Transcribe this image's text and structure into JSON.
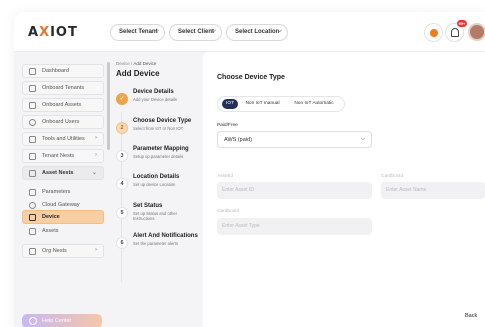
{
  "app": {
    "logo_prefix": "A",
    "logo_x": "X",
    "logo_suffix": "IOT"
  },
  "header": {
    "selectors": [
      {
        "label": "Select Tenant"
      },
      {
        "label": "Select Client"
      },
      {
        "label": "Select Location"
      }
    ],
    "notification_count": "99+",
    "user_initial": "F"
  },
  "sidebar": {
    "items": [
      {
        "label": "Dashboard",
        "icon": "dashboard-icon"
      },
      {
        "label": "Onboard Tenants",
        "icon": "tenants-icon"
      },
      {
        "label": "Onboard Assets",
        "icon": "assets-icon"
      },
      {
        "label": "Onboard Users",
        "icon": "users-icon"
      },
      {
        "label": "Tools and Utilities",
        "icon": "tools-icon"
      },
      {
        "label": "Tenant Nests",
        "icon": "nests-icon"
      },
      {
        "label": "Asset Nests",
        "icon": "asset-nests-icon"
      },
      {
        "label": "Parameters",
        "icon": "parameters-icon"
      },
      {
        "label": "Cloud Gateway",
        "icon": "cloud-icon"
      },
      {
        "label": "Device",
        "icon": "device-icon"
      },
      {
        "label": "Assets",
        "icon": "asset-icon"
      },
      {
        "label": "Org Nests",
        "icon": "org-icon"
      }
    ],
    "help_label": "Help Center"
  },
  "breadcrumb": {
    "parent": "Device",
    "separator": "/",
    "current": "Add Device"
  },
  "page_title": "Add Device",
  "steps": [
    {
      "num": "1",
      "title": "Device Details",
      "desc": "Add your Device details",
      "state": "done"
    },
    {
      "num": "2",
      "title": "Choose Device Type",
      "desc": "Select from IoT or Non IOT",
      "state": "current"
    },
    {
      "num": "3",
      "title": "Parameter Mapping",
      "desc": "Setup up parameter details",
      "state": "todo"
    },
    {
      "num": "4",
      "title": "Location Details",
      "desc": "Set up device Location",
      "state": "todo"
    },
    {
      "num": "5",
      "title": "Set Status",
      "desc": "Set up Status and other Instructions",
      "state": "todo"
    },
    {
      "num": "6",
      "title": "Alert And Notifications",
      "desc": "Set the parameter alerts",
      "state": "todo"
    }
  ],
  "form": {
    "section_title": "Choose Device Type",
    "tabs": [
      {
        "label": "IOT",
        "active": true
      },
      {
        "label": "Non IoT manual",
        "active": false
      },
      {
        "label": "Non IoT Automatic",
        "active": false
      }
    ],
    "paid_free_label": "Paid/Free",
    "paid_free_value": "AWS (paid)",
    "asset_id_label": "AssetId",
    "asset_id_placeholder": "Enter Asset ID",
    "asset_name_label": "CardboxId",
    "asset_name_placeholder": "Enter Asset Name",
    "asset_type_label": "CardboxId",
    "asset_type_placeholder": "Enter Asset Type"
  },
  "footer": {
    "back_label": "Back"
  },
  "colors": {
    "accent": "#f0a34a",
    "active_tab": "#22305a",
    "active_sidebar": "#f8cfa2"
  }
}
